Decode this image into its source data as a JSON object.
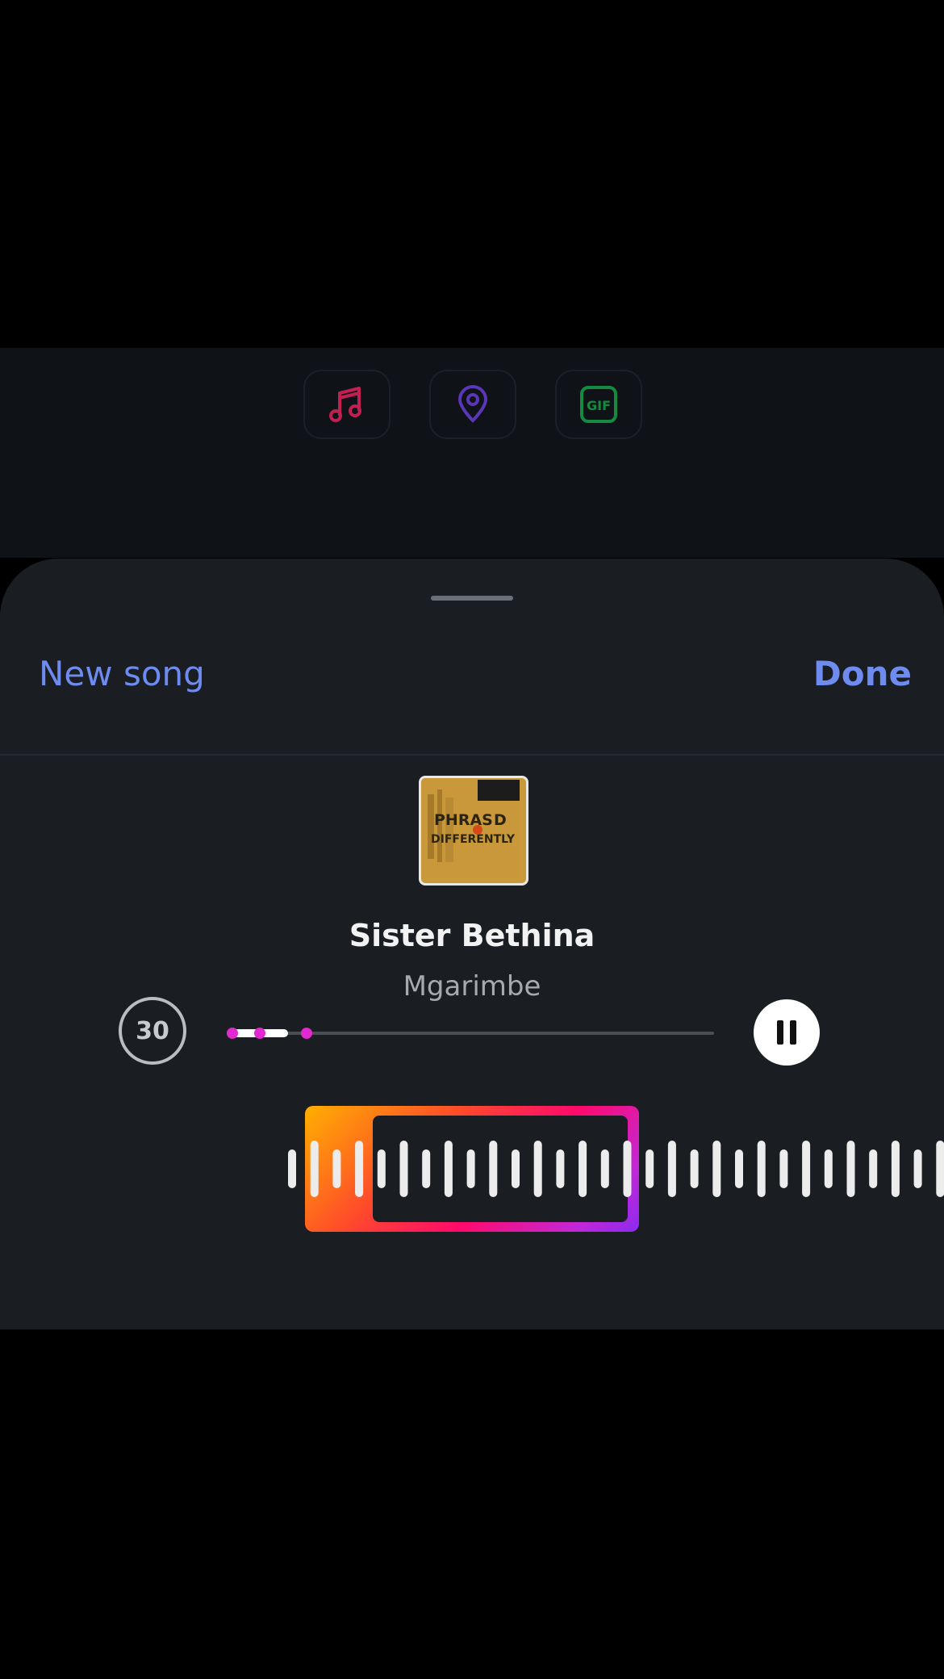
{
  "stickers": [
    {
      "name": "music",
      "color": "#e0245e"
    },
    {
      "name": "location",
      "color": "#6a3fd6"
    },
    {
      "name": "gif",
      "color": "#18a04a",
      "label": "GIF"
    }
  ],
  "sheet": {
    "new_song_label": "New song",
    "done_label": "Done"
  },
  "song": {
    "album_art_text": [
      "PHRAS",
      "D",
      "DIFFERENTLY"
    ],
    "title": "Sister Bethina",
    "artist": "Mgarimbe"
  },
  "player": {
    "duration_seconds": "30",
    "progress_fraction": 0.12,
    "state": "playing"
  },
  "colors": {
    "accent": "#6e8cf0",
    "sheet_bg": "#1a1d22",
    "marker": "#e02ad0"
  }
}
